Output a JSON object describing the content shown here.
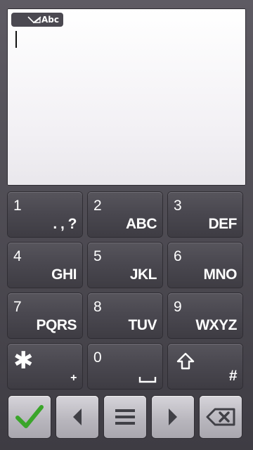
{
  "input": {
    "mode_label": "Abc",
    "text_value": ""
  },
  "keypad": {
    "keys": [
      {
        "number": "1",
        "letters": ". , ?"
      },
      {
        "number": "2",
        "letters": "ABC"
      },
      {
        "number": "3",
        "letters": "DEF"
      },
      {
        "number": "4",
        "letters": "GHI"
      },
      {
        "number": "5",
        "letters": "JKL"
      },
      {
        "number": "6",
        "letters": "MNO"
      },
      {
        "number": "7",
        "letters": "PQRS"
      },
      {
        "number": "8",
        "letters": "TUV"
      },
      {
        "number": "9",
        "letters": "WXYZ"
      },
      {
        "number": "✱",
        "letters": "+"
      },
      {
        "number": "0",
        "letters": "⎵"
      },
      {
        "number": "⇧",
        "letters": "#"
      }
    ]
  },
  "bottom_bar": {
    "icons": [
      "checkmark-icon",
      "arrow-left-icon",
      "menu-icon",
      "arrow-right-icon",
      "backspace-icon"
    ]
  },
  "colors": {
    "background": "#4a4850",
    "key": "#4a4850",
    "text": "#ffffff",
    "checkmark": "#3aa52a",
    "bottom_key": "#c4c2c8"
  }
}
